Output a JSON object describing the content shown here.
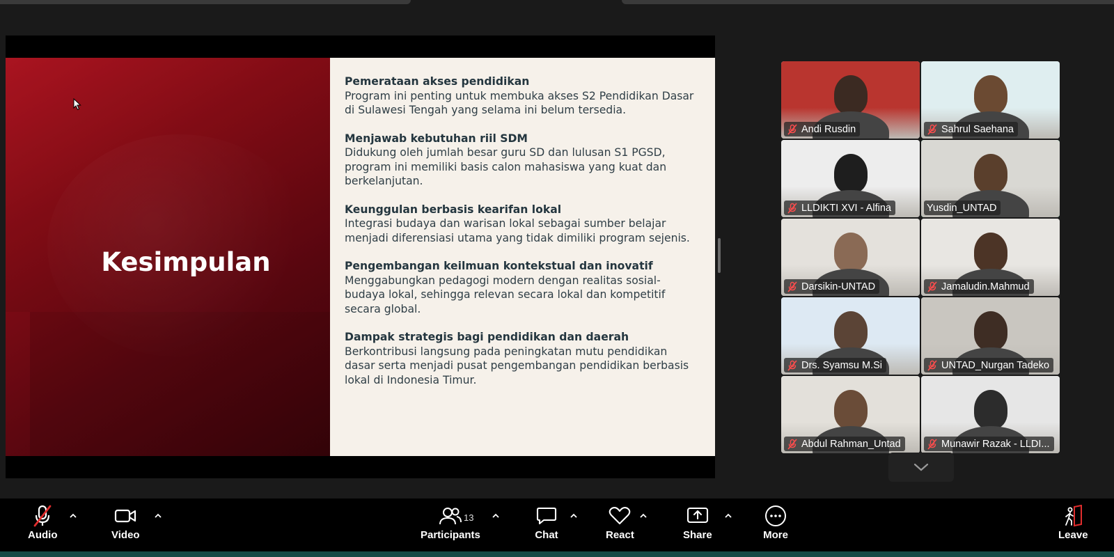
{
  "slide": {
    "title": "Kesimpulan",
    "points": [
      {
        "title": "Pemerataan akses pendidikan",
        "body": "Program ini penting untuk membuka akses S2 Pendidikan Dasar di Sulawesi Tengah yang selama ini belum tersedia."
      },
      {
        "title": "Menjawab kebutuhan riil SDM",
        "body": "Didukung oleh jumlah besar guru SD dan lulusan S1 PGSD, program ini memiliki basis calon mahasiswa yang kuat dan berkelanjutan."
      },
      {
        "title": "Keunggulan berbasis kearifan lokal",
        "body": "Integrasi budaya dan warisan lokal sebagai sumber belajar menjadi diferensiasi utama yang tidak dimiliki program sejenis."
      },
      {
        "title": "Pengembangan keilmuan kontekstual dan inovatif",
        "body": "Menggabungkan pedagogi modern dengan realitas sosial-budaya lokal, sehingga relevan secara lokal dan kompetitif secara global."
      },
      {
        "title": "Dampak strategis bagi pendidikan dan daerah",
        "body": "Berkontribusi langsung pada peningkatan mutu pendidikan dasar serta menjadi pusat pengembangan pendidikan berbasis lokal di Indonesia Timur."
      }
    ]
  },
  "participants": [
    {
      "name": "Andi Rusdin",
      "muted": true,
      "speaking": false,
      "bg": "#b9352f",
      "skin": "#3b2a22"
    },
    {
      "name": "Sahrul Saehana",
      "muted": true,
      "speaking": false,
      "bg": "#dfeef0",
      "skin": "#6b4a32"
    },
    {
      "name": "LLDIKTI XVI - Alfina",
      "muted": true,
      "speaking": false,
      "bg": "#ededed",
      "skin": "#1e1e1e"
    },
    {
      "name": "Yusdin_UNTAD",
      "muted": false,
      "speaking": true,
      "bg": "#d9d8d3",
      "skin": "#5a3f2c"
    },
    {
      "name": "Darsikin-UNTAD",
      "muted": true,
      "speaking": false,
      "bg": "#e4e1dc",
      "skin": "#8a6a55"
    },
    {
      "name": "Jamaludin.Mahmud",
      "muted": true,
      "speaking": false,
      "bg": "#e8e6e2",
      "skin": "#4c3426"
    },
    {
      "name": "Drs. Syamsu M.Si",
      "muted": true,
      "speaking": false,
      "bg": "#dde9f3",
      "skin": "#5b4436"
    },
    {
      "name": "UNTAD_Nurgan Tadeko",
      "muted": true,
      "speaking": false,
      "bg": "#c9c6c0",
      "skin": "#3e2d24"
    },
    {
      "name": "Abdul Rahman_Untad",
      "muted": true,
      "speaking": false,
      "bg": "#e3e0da",
      "skin": "#6a4c38"
    },
    {
      "name": "Munawir Razak - LLDI...",
      "muted": true,
      "speaking": false,
      "bg": "#e6e6e6",
      "skin": "#2c2c2c"
    }
  ],
  "toolbar": {
    "audio": "Audio",
    "video": "Video",
    "participants": "Participants",
    "participants_count": "13",
    "chat": "Chat",
    "react": "React",
    "share": "Share",
    "more": "More",
    "leave": "Leave"
  },
  "colors": {
    "leave_accent": "#e02d2d",
    "speaking_outline": "#23d18b",
    "slide_red": "#8a0d17",
    "slide_text": "#2a3a44"
  }
}
